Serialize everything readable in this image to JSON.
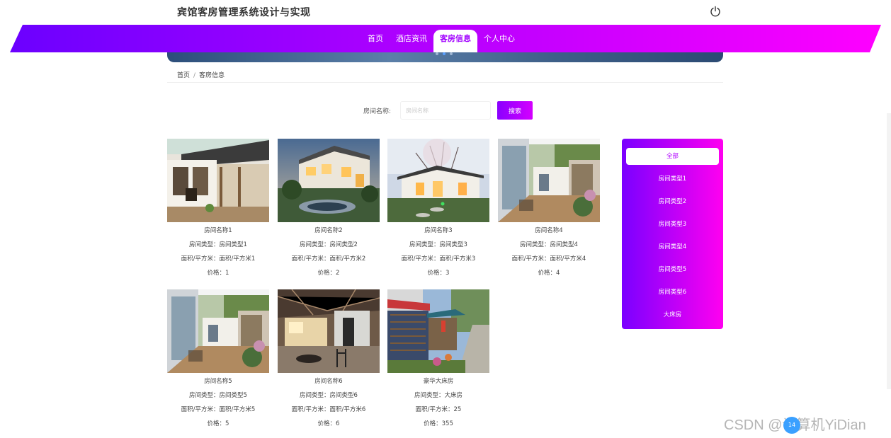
{
  "site": {
    "title": "宾馆客房管理系统设计与实现"
  },
  "nav": {
    "items": [
      "首页",
      "酒店资讯",
      "客房信息",
      "个人中心"
    ],
    "active_index": 2
  },
  "breadcrumb": {
    "home": "首页",
    "sep": "/",
    "current": "客房信息"
  },
  "search": {
    "label": "房间名称:",
    "placeholder": "房间名称",
    "button": "搜索"
  },
  "rooms": [
    {
      "name": "房间名称1",
      "type": "房间类型：房间类型1",
      "area": "面积/平方米：面积/平方米1",
      "price": "价格：1"
    },
    {
      "name": "房间名称2",
      "type": "房间类型：房间类型2",
      "area": "面积/平方米：面积/平方米2",
      "price": "价格：2"
    },
    {
      "name": "房间名称3",
      "type": "房间类型：房间类型3",
      "area": "面积/平方米：面积/平方米3",
      "price": "价格：3"
    },
    {
      "name": "房间名称4",
      "type": "房间类型：房间类型4",
      "area": "面积/平方米：面积/平方米4",
      "price": "价格：4"
    },
    {
      "name": "房间名称5",
      "type": "房间类型：房间类型5",
      "area": "面积/平方米：面积/平方米5",
      "price": "价格：5"
    },
    {
      "name": "房间名称6",
      "type": "房间类型：房间类型6",
      "area": "面积/平方米：面积/平方米6",
      "price": "价格：6"
    },
    {
      "name": "豪华大床房",
      "type": "房间类型：大床房",
      "area": "面积/平方米：25",
      "price": "价格：355"
    }
  ],
  "categories": {
    "items": [
      "全部",
      "房间类型1",
      "房间类型2",
      "房间类型3",
      "房间类型4",
      "房间类型5",
      "房间类型6",
      "大床房"
    ],
    "active_index": 0
  },
  "watermark": {
    "text": "CSDN @计算机YiDian",
    "badge": "14"
  },
  "colors": {
    "gradient_start": "#6b00ff",
    "gradient_end": "#ff00ff",
    "accent": "#a100ff"
  },
  "icons": {
    "power": "power-icon"
  }
}
